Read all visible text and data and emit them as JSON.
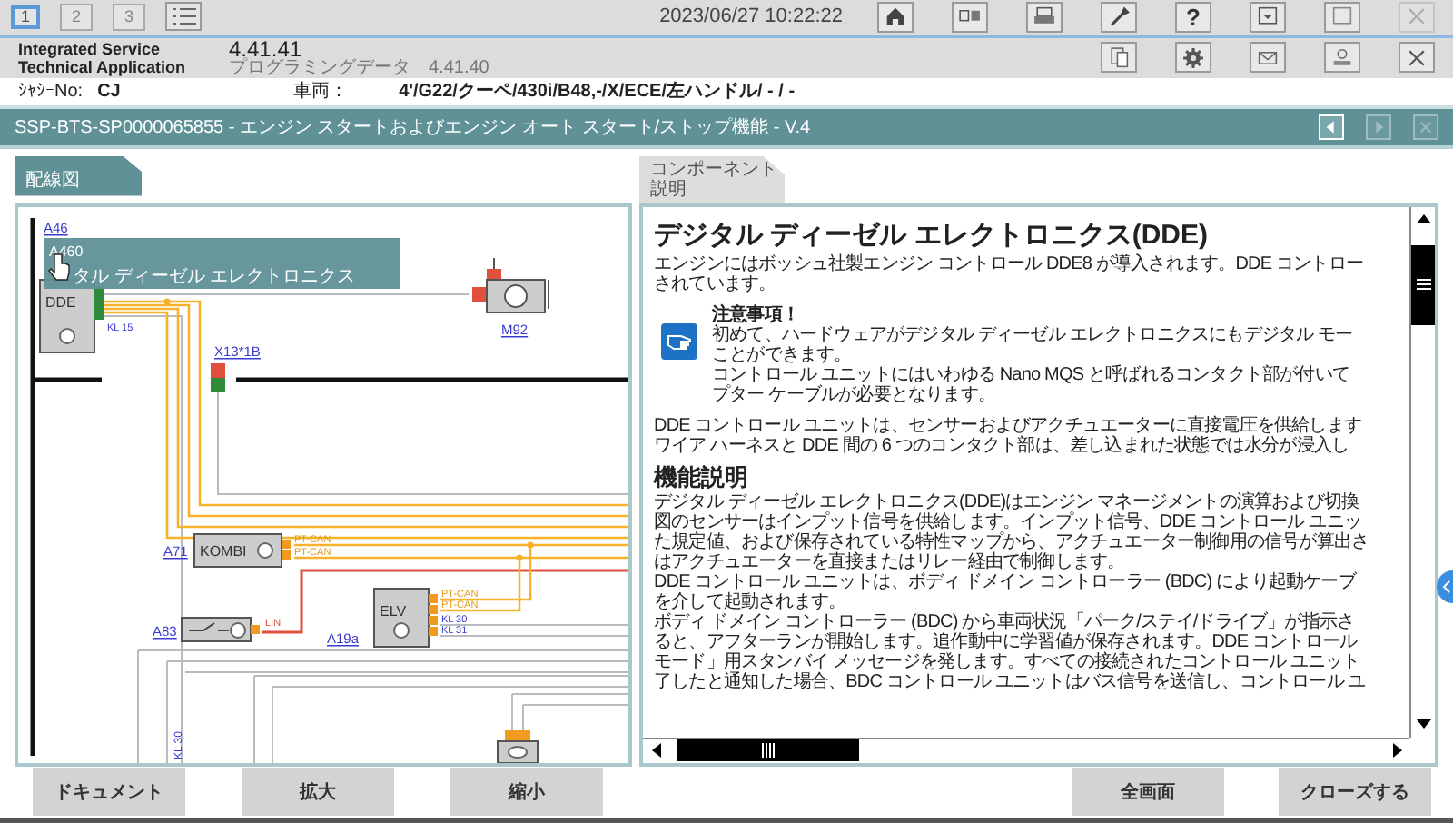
{
  "top_bar": {
    "tabs": [
      {
        "label": "1",
        "selected": true
      },
      {
        "label": "2",
        "selected": false
      },
      {
        "label": "3",
        "selected": false
      }
    ],
    "datetime": "2023/06/27 10:22:22",
    "tools": [
      {
        "kind": "home",
        "disabled": false
      },
      {
        "kind": "panels",
        "disabled": false
      },
      {
        "kind": "printer",
        "disabled": false
      },
      {
        "kind": "wrench",
        "disabled": false
      },
      {
        "kind": "help",
        "label": "?",
        "disabled": false
      },
      {
        "kind": "minimize",
        "disabled": false
      },
      {
        "kind": "window",
        "disabled": false
      },
      {
        "kind": "close",
        "disabled": true
      }
    ]
  },
  "app": {
    "name": "Integrated Service Technical Application",
    "version": "4.41.41",
    "programming_label": "プログラミングデータ",
    "programming_version": "4.41.40",
    "tools": [
      {
        "kind": "document",
        "disabled": false
      },
      {
        "kind": "gear",
        "disabled": false
      },
      {
        "kind": "mail",
        "disabled": false
      },
      {
        "kind": "ar",
        "disabled": false
      },
      {
        "kind": "close",
        "disabled": false
      }
    ]
  },
  "vehicle": {
    "chassis_label": "ｼｬｼｰNo:",
    "chassis_value": "CJ",
    "model_label": "車両：",
    "model_value": "4'/G22/クーペ/430i/B48,-/X/ECE/左ハンドル/ - / -"
  },
  "title_bar": {
    "title": "SSP-BTS-SP0000065855 - エンジン スタートおよびエンジン オート スタート/ストップ機能 - V.4",
    "buttons": [
      {
        "kind": "prev",
        "disabled": false
      },
      {
        "kind": "next",
        "disabled": true
      },
      {
        "kind": "close",
        "disabled": true
      }
    ]
  },
  "wiring_panel": {
    "tab": "配線図",
    "tooltip": {
      "code": "A460",
      "text": "タル ディーゼル エレクトロニクス"
    },
    "components": [
      {
        "kind": "control_unit",
        "link": "A46",
        "name": "DDE",
        "pins": [
          "KL 15"
        ]
      },
      {
        "kind": "connector",
        "link": "X13*1B"
      },
      {
        "kind": "motor",
        "link": "M92"
      },
      {
        "kind": "control_unit",
        "link": "A71",
        "name": "KOMBI",
        "pins": [
          "PT-CAN",
          "PT-CAN"
        ]
      },
      {
        "kind": "switch",
        "link": "A83",
        "pins": [
          "LIN"
        ]
      },
      {
        "kind": "control_unit",
        "link": "A19a",
        "name": "ELV",
        "pins": [
          "PT-CAN",
          "PT-CAN",
          "KL 30",
          "KL 31"
        ]
      },
      {
        "kind": "sensor"
      }
    ],
    "wire_label": "KL 30"
  },
  "description_panel": {
    "tab_lines": [
      "コンポーネント",
      "説明"
    ],
    "blocks": [
      {
        "kind": "title",
        "text": "デジタル ディーゼル エレクトロニクス(DDE)"
      },
      {
        "kind": "paragraph",
        "lines": [
          "エンジンにはボッシュ社製エンジン コントロール DDE8 が導入されます。DDE コントロー",
          "されています。"
        ]
      },
      {
        "kind": "note",
        "title": "注意事項！",
        "lines": [
          "初めて、ハードウェアがデジタル ディーゼル エレクトロニクスにもデジタル モー",
          "ことができます。",
          "コントロール ユニットにはいわゆる Nano MQS と呼ばれるコンタクト部が付いて",
          "プター ケーブルが必要となります。"
        ]
      },
      {
        "kind": "paragraph",
        "lines": [
          "DDE コントロール ユニットは、センサーおよびアクチュエーターに直接電圧を供給します",
          "ワイア ハーネスと DDE 間の 6 つのコンタクト部は、差し込まれた状態では水分が浸入し"
        ]
      },
      {
        "kind": "heading",
        "text": "機能説明"
      },
      {
        "kind": "paragraph",
        "lines": [
          "デジタル ディーゼル エレクトロニクス(DDE)はエンジン マネージメントの演算および切換",
          "図のセンサーはインプット信号を供給します。インプット信号、DDE コントロール ユニッ",
          "た規定値、および保存されている特性マップから、アクチュエーター制御用の信号が算出さ",
          "はアクチュエーターを直接またはリレー経由で制御します。",
          "DDE コントロール ユニットは、ボディ ドメイン コントローラー (BDC) により起動ケーブ",
          "を介して起動されます。",
          "ボディ ドメイン コントローラー (BDC) から車両状況「パーク/ステイ/ドライブ」が指示さ",
          "ると、アフターランが開始します。追作動中に学習値が保存されます。DDE コントロール",
          "モード」用スタンバイ メッセージを発します。すべての接続されたコントロール ユニット",
          "了したと通知した場合、BDC コントロール ユニットはバス信号を送信し、コントロール ユ"
        ]
      }
    ]
  },
  "bottom_bar": {
    "left": [
      "ドキュメント",
      "拡大",
      "縮小"
    ],
    "right": [
      "全画面",
      "クローズする"
    ]
  }
}
